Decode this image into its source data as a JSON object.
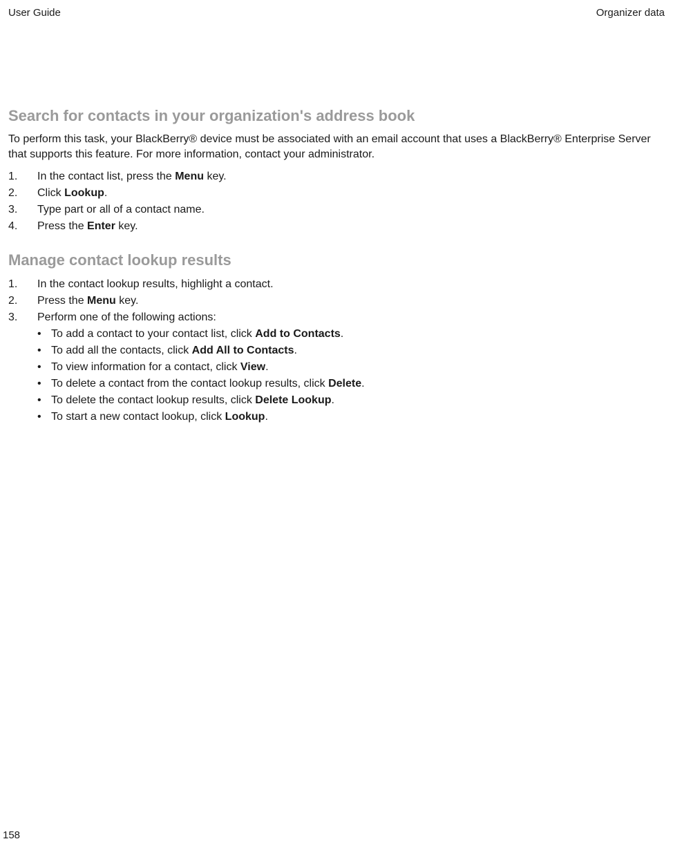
{
  "header": {
    "left": "User Guide",
    "right": "Organizer data"
  },
  "section1": {
    "title": "Search for contacts in your organization's address book",
    "intro": "To perform this task, your BlackBerry® device must be associated with an email account that uses a BlackBerry® Enterprise Server that supports this feature. For more information, contact your administrator.",
    "steps": {
      "s1a": "In the contact list, press the ",
      "s1b": "Menu",
      "s1c": " key.",
      "s2a": "Click ",
      "s2b": "Lookup",
      "s2c": ".",
      "s3": "Type part or all of a contact name.",
      "s4a": "Press the ",
      "s4b": "Enter",
      "s4c": " key."
    }
  },
  "section2": {
    "title": "Manage contact lookup results",
    "steps": {
      "s1": "In the contact lookup results, highlight a contact.",
      "s2a": "Press the ",
      "s2b": "Menu",
      "s2c": " key.",
      "s3": "Perform one of the following actions:"
    },
    "bullets": {
      "b1a": "To add a contact to your contact list, click ",
      "b1b": "Add to Contacts",
      "b1c": ".",
      "b2a": "To add all the contacts, click ",
      "b2b": "Add All to Contacts",
      "b2c": ".",
      "b3a": "To view information for a contact, click ",
      "b3b": "View",
      "b3c": ".",
      "b4a": "To delete a contact from the contact lookup results, click ",
      "b4b": "Delete",
      "b4c": ".",
      "b5a": "To delete the contact lookup results, click ",
      "b5b": "Delete Lookup",
      "b5c": ".",
      "b6a": "To start a new contact lookup, click ",
      "b6b": "Lookup",
      "b6c": "."
    }
  },
  "pageNumber": "158"
}
